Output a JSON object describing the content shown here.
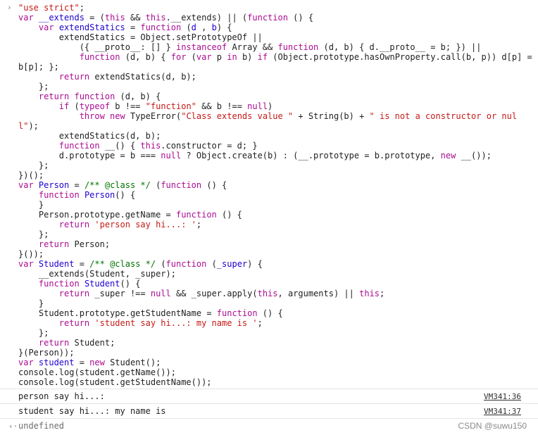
{
  "code_lines": [
    [
      [
        "str",
        "\"use strict\""
      ],
      [
        "",
        "; "
      ]
    ],
    [
      [
        "kw",
        "var "
      ],
      [
        "idf",
        "__extends"
      ],
      [
        "",
        " = ("
      ],
      [
        "kw",
        "this"
      ],
      [
        "",
        " && "
      ],
      [
        "kw",
        "this"
      ],
      [
        "",
        ".__extends) || ("
      ],
      [
        "kw",
        "function"
      ],
      [
        "",
        " () {"
      ]
    ],
    [
      [
        "",
        "    "
      ],
      [
        "kw",
        "var "
      ],
      [
        "idf",
        "extendStatics"
      ],
      [
        "",
        " = "
      ],
      [
        "kw",
        "function"
      ],
      [
        "",
        " ("
      ],
      [
        "idf",
        "d"
      ],
      [
        "",
        " , "
      ],
      [
        "idf",
        "b"
      ],
      [
        "",
        ") {"
      ]
    ],
    [
      [
        "",
        "        extendStatics = Object.setPrototypeOf ||"
      ]
    ],
    [
      [
        "",
        "            ({ __proto__: [] } "
      ],
      [
        "kw",
        "instanceof"
      ],
      [
        "",
        " Array && "
      ],
      [
        "kw",
        "function"
      ],
      [
        "",
        " (d, b) { d.__proto__ = b; }) ||"
      ]
    ],
    [
      [
        "",
        "            "
      ],
      [
        "kw",
        "function"
      ],
      [
        "",
        " (d, b) { "
      ],
      [
        "kw",
        "for"
      ],
      [
        "",
        " ("
      ],
      [
        "kw",
        "var"
      ],
      [
        "",
        " p "
      ],
      [
        "kw",
        "in"
      ],
      [
        "",
        " b) "
      ],
      [
        "kw",
        "if"
      ],
      [
        "",
        " (Object.prototype.hasOwnProperty.call(b, p)) d[p] = b[p]; };"
      ]
    ],
    [
      [
        "",
        "        "
      ],
      [
        "kw",
        "return"
      ],
      [
        "",
        " extendStatics(d, b);"
      ]
    ],
    [
      [
        "",
        "    };"
      ]
    ],
    [
      [
        "",
        "    "
      ],
      [
        "kw",
        "return"
      ],
      [
        "kw",
        " function"
      ],
      [
        "",
        " (d, b) {"
      ]
    ],
    [
      [
        "",
        "        "
      ],
      [
        "kw",
        "if"
      ],
      [
        "",
        " ("
      ],
      [
        "kw",
        "typeof"
      ],
      [
        "",
        " b !== "
      ],
      [
        "str",
        "\"function\""
      ],
      [
        "",
        " && b !== "
      ],
      [
        "kw",
        "null"
      ],
      [
        "",
        ")"
      ]
    ],
    [
      [
        "",
        "            "
      ],
      [
        "kw",
        "throw new"
      ],
      [
        "",
        " TypeError("
      ],
      [
        "str",
        "\"Class extends value \""
      ],
      [
        "",
        " + String(b) + "
      ],
      [
        "str",
        "\" is not a constructor or null\""
      ],
      [
        "",
        ");"
      ]
    ],
    [
      [
        "",
        "        extendStatics(d, b);"
      ]
    ],
    [
      [
        "",
        "        "
      ],
      [
        "kw",
        "function"
      ],
      [
        "",
        " __() { "
      ],
      [
        "kw",
        "this"
      ],
      [
        "",
        ".constructor = d; }"
      ]
    ],
    [
      [
        "",
        "        d.prototype = b === "
      ],
      [
        "kw",
        "null"
      ],
      [
        "",
        " ? Object.create(b) : (__.prototype = b.prototype, "
      ],
      [
        "kw",
        "new"
      ],
      [
        "",
        " __());"
      ]
    ],
    [
      [
        "",
        "    };"
      ]
    ],
    [
      [
        "",
        "})();"
      ]
    ],
    [
      [
        "kw",
        "var "
      ],
      [
        "idf",
        "Person"
      ],
      [
        "",
        " = "
      ],
      [
        "cm",
        "/** @class */"
      ],
      [
        "",
        " ("
      ],
      [
        "kw",
        "function"
      ],
      [
        "",
        " () {"
      ]
    ],
    [
      [
        "",
        "    "
      ],
      [
        "kw",
        "function"
      ],
      [
        "",
        " "
      ],
      [
        "idf",
        "Person"
      ],
      [
        "",
        "() {"
      ]
    ],
    [
      [
        "",
        "    }"
      ]
    ],
    [
      [
        "",
        "    Person.prototype.getName = "
      ],
      [
        "kw",
        "function"
      ],
      [
        "",
        " () {"
      ]
    ],
    [
      [
        "",
        "        "
      ],
      [
        "kw",
        "return"
      ],
      [
        "",
        " "
      ],
      [
        "str",
        "'person say hi...: '"
      ],
      [
        "",
        ";"
      ]
    ],
    [
      [
        "",
        "    };"
      ]
    ],
    [
      [
        "",
        "    "
      ],
      [
        "kw",
        "return"
      ],
      [
        "",
        " Person;"
      ]
    ],
    [
      [
        "",
        "}());"
      ]
    ],
    [
      [
        "kw",
        "var "
      ],
      [
        "idf",
        "Student"
      ],
      [
        "",
        " = "
      ],
      [
        "cm",
        "/** @class */"
      ],
      [
        "",
        " ("
      ],
      [
        "kw",
        "function"
      ],
      [
        "",
        " ("
      ],
      [
        "idf",
        "_super"
      ],
      [
        "",
        ") {"
      ]
    ],
    [
      [
        "",
        "    __extends(Student, _super);"
      ]
    ],
    [
      [
        "",
        "    "
      ],
      [
        "kw",
        "function"
      ],
      [
        "",
        " "
      ],
      [
        "idf",
        "Student"
      ],
      [
        "",
        "() {"
      ]
    ],
    [
      [
        "",
        "        "
      ],
      [
        "kw",
        "return"
      ],
      [
        "",
        " _super !== "
      ],
      [
        "kw",
        "null"
      ],
      [
        "",
        " && _super.apply("
      ],
      [
        "kw",
        "this"
      ],
      [
        "",
        ", arguments) || "
      ],
      [
        "kw",
        "this"
      ],
      [
        "",
        ";"
      ]
    ],
    [
      [
        "",
        "    }"
      ]
    ],
    [
      [
        "",
        "    Student.prototype.getStudentName = "
      ],
      [
        "kw",
        "function"
      ],
      [
        "",
        " () {"
      ]
    ],
    [
      [
        "",
        "        "
      ],
      [
        "kw",
        "return"
      ],
      [
        "",
        " "
      ],
      [
        "str",
        "'student say hi...: my name is '"
      ],
      [
        "",
        ";"
      ]
    ],
    [
      [
        "",
        "    };"
      ]
    ],
    [
      [
        "",
        "    "
      ],
      [
        "kw",
        "return"
      ],
      [
        "",
        " Student;"
      ]
    ],
    [
      [
        "",
        "}(Person));"
      ]
    ],
    [
      [
        "kw",
        "var "
      ],
      [
        "idf",
        "student"
      ],
      [
        "",
        " = "
      ],
      [
        "kw",
        "new"
      ],
      [
        "",
        " Student();"
      ]
    ],
    [
      [
        "",
        "console.log(student.getName());"
      ]
    ],
    [
      [
        "",
        "console.log(student.getStudentName());"
      ]
    ]
  ],
  "outputs": [
    {
      "text": "person say hi...: ",
      "source": "VM341:36"
    },
    {
      "text": "student say hi...: my name is ",
      "source": "VM341:37"
    }
  ],
  "result": {
    "text": "undefined"
  },
  "watermark": "CSDN @suwu150",
  "colors": {
    "keyword": "#aa0d91",
    "string": "#c41a16",
    "identifier": "#1c00cf",
    "comment": "#007400"
  }
}
